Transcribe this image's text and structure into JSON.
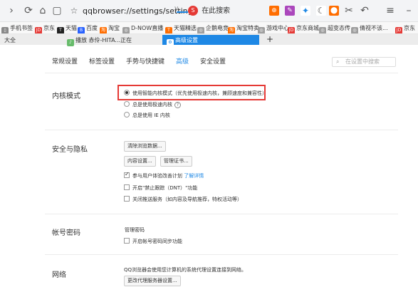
{
  "toolbar": {
    "address": "qqbrowser://settings/settings-a",
    "search_placeholder": "在此搜索",
    "search_logo": "S"
  },
  "bookmarks": [
    {
      "label": "手机书签",
      "icon": "phone-icon",
      "color": "#888888",
      "glyph": "▯"
    },
    {
      "label": "京东",
      "icon": "jd-icon",
      "color": "#e53935",
      "glyph": "JD"
    },
    {
      "label": "天猫",
      "icon": "tmall-icon",
      "color": "#222222",
      "glyph": "T"
    },
    {
      "label": "百度",
      "icon": "baidu-icon",
      "color": "#2962ff",
      "glyph": "B"
    },
    {
      "label": "淘宝",
      "icon": "taobao-icon",
      "color": "#ff6d00",
      "glyph": "淘"
    },
    {
      "label": "D-NOW直播",
      "icon": "globe-icon",
      "color": "#9e9e9e",
      "glyph": "◎"
    },
    {
      "label": "天猫精选",
      "icon": "tmall-icon",
      "color": "#ff6d00",
      "glyph": "T"
    },
    {
      "label": "企鹅电竞",
      "icon": "globe-icon",
      "color": "#9e9e9e",
      "glyph": "◎"
    },
    {
      "label": "淘宝特卖",
      "icon": "taobao-icon",
      "color": "#ff6d00",
      "glyph": "淘"
    },
    {
      "label": "游戏中心",
      "icon": "globe-icon",
      "color": "#9e9e9e",
      "glyph": "◎"
    },
    {
      "label": "京东商城",
      "icon": "jd-icon",
      "color": "#e53935",
      "glyph": "JD"
    },
    {
      "label": "超变态传",
      "icon": "globe-icon",
      "color": "#9e9e9e",
      "glyph": "◎"
    },
    {
      "label": "倩视不该...",
      "icon": "globe-icon",
      "color": "#9e9e9e",
      "glyph": "◎"
    },
    {
      "label": "京东",
      "icon": "jd-icon",
      "color": "#e53935",
      "glyph": "JD"
    }
  ],
  "tabs": [
    {
      "label": "大全",
      "active": false
    },
    {
      "label": "播放 赤伶-HITA...正在",
      "active": false
    },
    {
      "label": "高级设置",
      "active": true,
      "close": "×"
    }
  ],
  "new_tab": "+",
  "nav": [
    "常规设置",
    "标签设置",
    "手势与快捷键",
    "高级",
    "安全设置"
  ],
  "settings_search_placeholder": "在设置中搜索",
  "kernel": {
    "title": "内核模式",
    "options": [
      "使用智能内核模式（优先使用极速内核，兼顾速度和兼容性）",
      "总是使用极速内核",
      "总是使用 IE 内核"
    ],
    "help": "?"
  },
  "privacy": {
    "title": "安全与隐私",
    "clear_btn": "清除浏览数据...",
    "content_btn": "内容设置...",
    "cert_btn": "管理证书...",
    "ux_plan": "参与用户体验改善计划",
    "learn_more": "了解详情",
    "dnt": "开启\"禁止跟踪（DNT）\"功能",
    "push": "关闭推送服务（如内容及导航推荐，特权活动等）"
  },
  "account": {
    "title": "帐号密码",
    "manage": "管理密码",
    "sync": "开启帐号密码同步功能"
  },
  "network": {
    "title": "网络",
    "desc": "QQ浏览器会使用您计算机的系统代理设置连接到网络。",
    "proxy_btn": "更改代理服务器设置..."
  }
}
